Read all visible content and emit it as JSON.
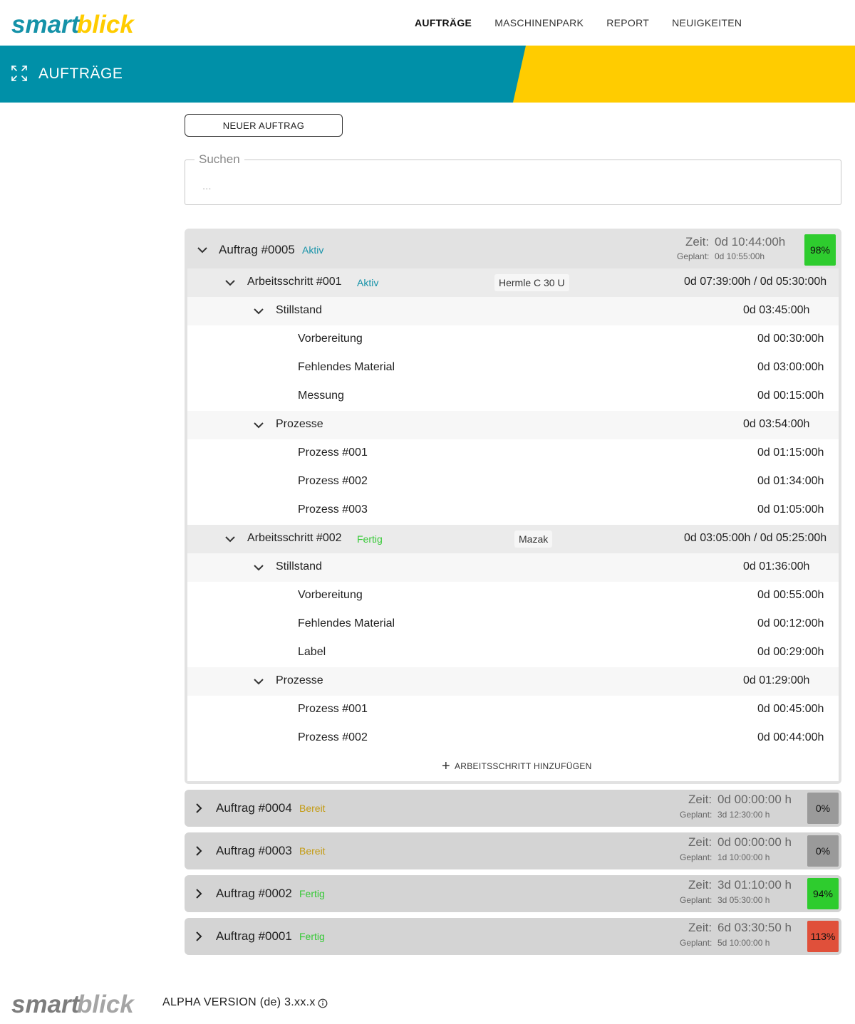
{
  "brand": {
    "name": "smartblick",
    "part1": "smart",
    "part2": "blick",
    "color_teal": "#1592a8",
    "color_yellow": "#ffcc00",
    "color_gray": "#8a8a8a"
  },
  "nav": {
    "items": [
      {
        "label": "AUFTRÄGE",
        "active": true
      },
      {
        "label": "MASCHINENPARK",
        "active": false
      },
      {
        "label": "REPORT",
        "active": false
      },
      {
        "label": "NEUIGKEITEN",
        "active": false
      }
    ]
  },
  "header": {
    "title": "AUFTRÄGE",
    "icon": "fullscreen-icon",
    "colors": {
      "band": "#0090a8",
      "accent": "#ffcc00"
    }
  },
  "toolbar": {
    "new_order_label": "NEUER AUFTRAG"
  },
  "search": {
    "legend": "Suchen",
    "placeholder": "...",
    "value": ""
  },
  "orders": {
    "expanded": {
      "name": "Auftrag #0005",
      "status": "Aktiv",
      "time_label": "Zeit:",
      "time": "0d 10:44:00h",
      "planned_label": "Geplant:",
      "planned": "0d 10:55:00h",
      "percent": "98%",
      "percent_color": "#2ecc2e",
      "steps": [
        {
          "name": "Arbeitsschritt #001",
          "status": "Aktiv",
          "machine": "Hermle C 30 U",
          "times": "0d 07:39:00h / 0d 05:30:00h",
          "groups": [
            {
              "name": "Stillstand",
              "time": "0d 03:45:00h",
              "items": [
                {
                  "name": "Vorbereitung",
                  "time": "0d 00:30:00h"
                },
                {
                  "name": "Fehlendes Material",
                  "time": "0d 03:00:00h"
                },
                {
                  "name": "Messung",
                  "time": "0d 00:15:00h"
                }
              ]
            },
            {
              "name": "Prozesse",
              "time": "0d 03:54:00h",
              "items": [
                {
                  "name": "Prozess #001",
                  "time": "0d 01:15:00h"
                },
                {
                  "name": "Prozess #002",
                  "time": "0d 01:34:00h"
                },
                {
                  "name": "Prozess #003",
                  "time": "0d 01:05:00h"
                }
              ]
            }
          ]
        },
        {
          "name": "Arbeitsschritt #002",
          "status": "Fertig",
          "machine": "Mazak",
          "times": "0d 03:05:00h / 0d 05:25:00h",
          "groups": [
            {
              "name": "Stillstand",
              "time": "0d 01:36:00h",
              "items": [
                {
                  "name": "Vorbereitung",
                  "time": "0d 00:55:00h"
                },
                {
                  "name": "Fehlendes Material",
                  "time": "0d 00:12:00h"
                },
                {
                  "name": "Label",
                  "time": "0d 00:29:00h"
                }
              ]
            },
            {
              "name": "Prozesse",
              "time": "0d 01:29:00h",
              "items": [
                {
                  "name": "Prozess #001",
                  "time": "0d 00:45:00h"
                },
                {
                  "name": "Prozess #002",
                  "time": "0d 00:44:00h"
                }
              ]
            }
          ]
        }
      ],
      "add_step_label": "ARBEITSSCHRITT HINZUFÜGEN"
    },
    "collapsed": [
      {
        "name": "Auftrag #0004",
        "status": "Bereit",
        "time_label": "Zeit:",
        "time": "0d 00:00:00 h",
        "planned_label": "Geplant:",
        "planned": "3d 12:30:00 h",
        "percent": "0%",
        "percent_color": "#9a9a9a"
      },
      {
        "name": "Auftrag #0003",
        "status": "Bereit",
        "time_label": "Zeit:",
        "time": "0d 00:00:00 h",
        "planned_label": "Geplant:",
        "planned": "1d 10:00:00 h",
        "percent": "0%",
        "percent_color": "#9a9a9a"
      },
      {
        "name": "Auftrag #0002",
        "status": "Fertig",
        "time_label": "Zeit:",
        "time": "3d 01:10:00 h",
        "planned_label": "Geplant:",
        "planned": "3d 05:30:00 h",
        "percent": "94%",
        "percent_color": "#2ecc2e"
      },
      {
        "name": "Auftrag #0001",
        "status": "Fertig",
        "time_label": "Zeit:",
        "time": "6d 03:30:50 h",
        "planned_label": "Geplant:",
        "planned": "5d 10:00:00 h",
        "percent": "113%",
        "percent_color": "#e0503a"
      }
    ]
  },
  "footer": {
    "version": "ALPHA VERSION (de) 3.xx.x",
    "icon": "info-icon"
  }
}
